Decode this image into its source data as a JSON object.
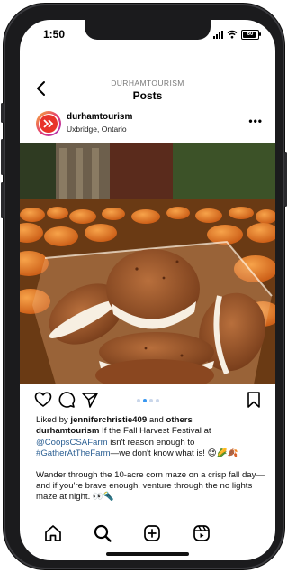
{
  "status": {
    "time": "1:50",
    "battery": "60"
  },
  "header": {
    "account": "DURHAMTOURISM",
    "title": "Posts"
  },
  "post": {
    "username": "durhamtourism",
    "location": "Uxbridge, Ontario",
    "image_alt": "Pumpkin whoopie pies in a plastic container in front of a pumpkin patch",
    "carousel": {
      "count": 4,
      "active": 2
    },
    "likes": {
      "prefix": "Liked by ",
      "user": "jenniferchristie409",
      "middle": " and ",
      "others": "others"
    },
    "caption": {
      "username": "durhamtourism",
      "t1": " If the Fall Harvest Festival at ",
      "mention": "@CoopsCSAFarm",
      "t2": " isn't reason enough to ",
      "hashtag": "#GatherAtTheFarm",
      "t3": "—we don't know what is! 😍🌽🍂",
      "p2": "Wander through the 10-acre corn maze on a crisp fall day—and if you're brave enough, venture through the no lights maze at night. 👀🔦"
    }
  },
  "colors": {
    "link": "#2b5f93",
    "accent": "#3897f0",
    "brand": "#e8332a"
  },
  "icons": {
    "back": "chevron-left-icon",
    "more": "more-horizontal-icon",
    "like": "heart-icon",
    "comment": "comment-icon",
    "share": "send-icon",
    "save": "bookmark-icon",
    "home": "home-icon",
    "search": "search-icon",
    "create": "plus-square-icon",
    "reels": "reels-icon"
  }
}
